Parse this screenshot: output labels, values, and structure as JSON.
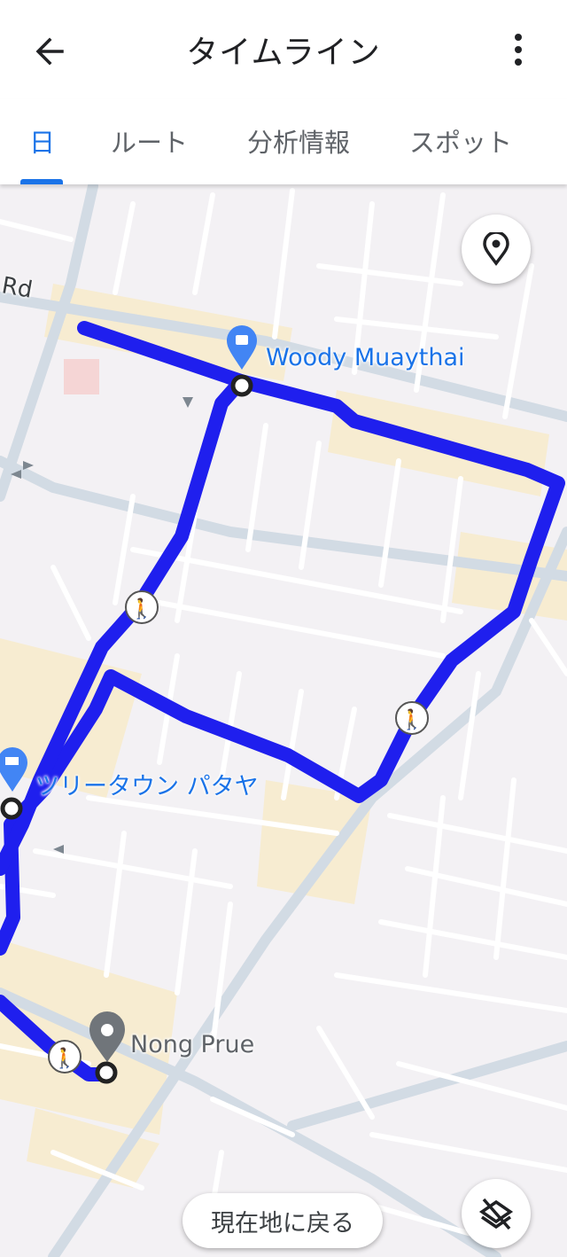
{
  "header": {
    "title": "タイムライン",
    "back_icon": "arrow-left-icon",
    "menu_icon": "more-vert-icon"
  },
  "tabs": [
    {
      "label": "日",
      "active": true
    },
    {
      "label": "ルート",
      "active": false
    },
    {
      "label": "分析情報",
      "active": false
    },
    {
      "label": "スポット",
      "active": false
    }
  ],
  "map": {
    "road_label": "Rd",
    "places": [
      {
        "name": "Woody Muaythai",
        "icon": "shopping-bag-pin-icon"
      },
      {
        "name": "ツリータウン パタヤ",
        "icon": "shopping-cart-pin-icon"
      },
      {
        "name": "Nong Prue",
        "icon": "gray-pin-icon"
      }
    ],
    "route_color": "#1f1fee",
    "walking_icon": "walking-person-icon",
    "my_location_icon": "location-pin-icon",
    "layers_icon": "layers-off-icon"
  },
  "return_button": {
    "label": "現在地に戻る"
  },
  "colors": {
    "accent": "#1a73e8",
    "route": "#1f1fee",
    "map_bg": "#f3f1f4"
  }
}
